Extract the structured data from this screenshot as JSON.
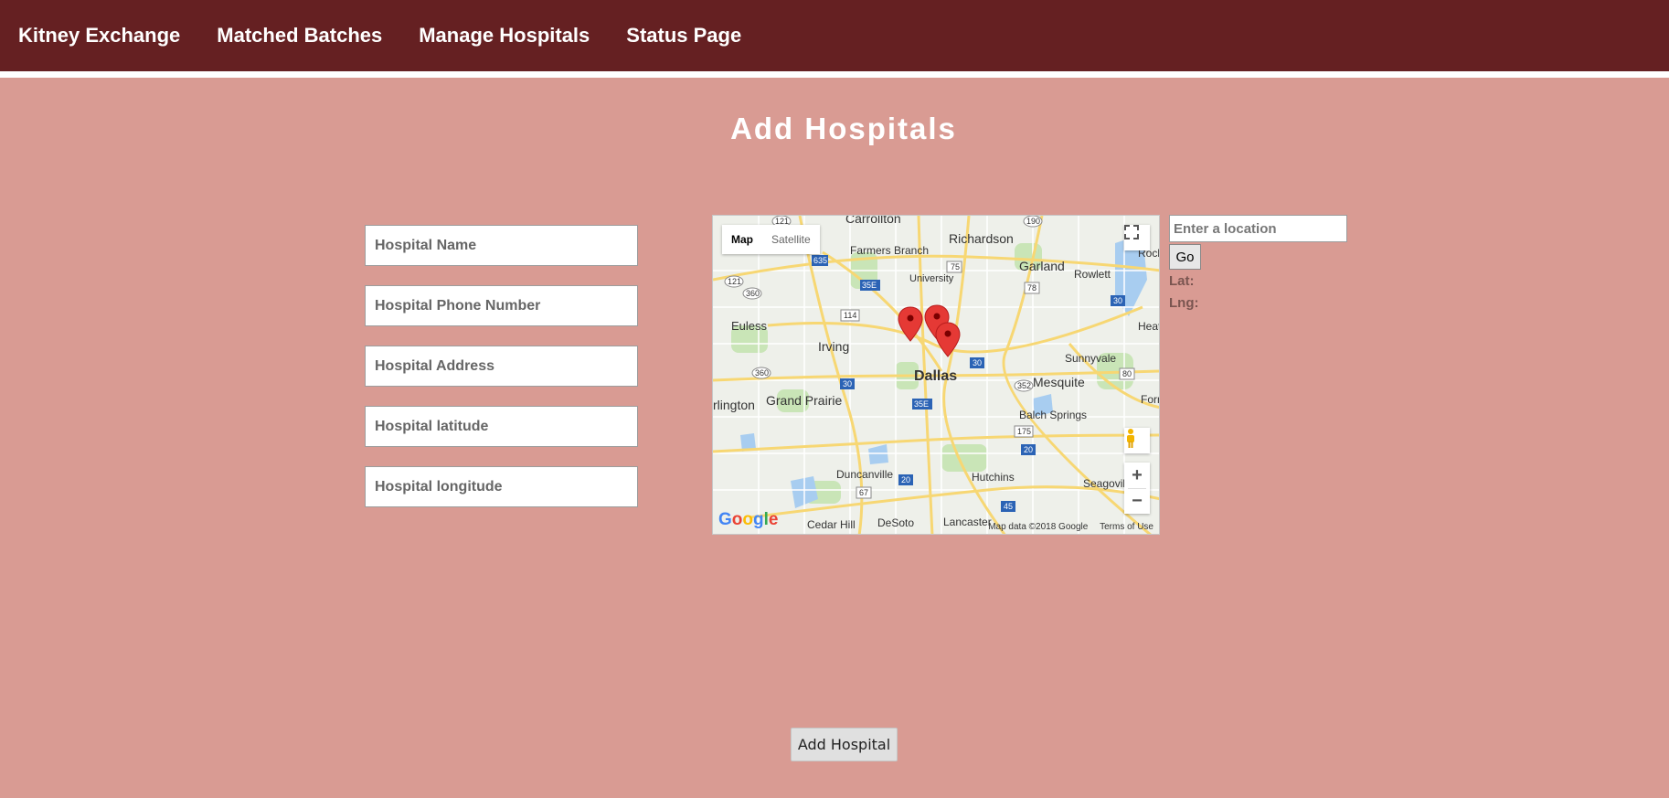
{
  "nav": {
    "items": [
      {
        "label": "Kitney Exchange"
      },
      {
        "label": "Matched Batches"
      },
      {
        "label": "Manage Hospitals"
      },
      {
        "label": "Status Page"
      }
    ]
  },
  "page": {
    "title": "Add Hospitals"
  },
  "form": {
    "name_placeholder": "Hospital Name",
    "phone_placeholder": "Hospital Phone Number",
    "address_placeholder": "Hospital Address",
    "latitude_placeholder": "Hospital latitude",
    "longitude_placeholder": "Hospital longitude",
    "submit_label": "Add Hospital"
  },
  "map": {
    "type_map_label": "Map",
    "type_satellite_label": "Satellite",
    "footer_data": "Map data ©2018 Google",
    "footer_terms": "Terms of Use",
    "google_label": "Google",
    "zoom_in": "+",
    "zoom_out": "−",
    "place_labels": [
      "Carrollton",
      "Richardson",
      "Garland",
      "Rowlett",
      "Rock",
      "Farmers Branch",
      "University",
      "Euless",
      "Irving",
      "Dallas",
      "Sunnyvale",
      "Heath",
      "Mesquite",
      "Grand Prairie",
      "rlington",
      "Balch Springs",
      "Duncanville",
      "Hutchins",
      "Seagovill",
      "Cedar Hill",
      "DeSoto",
      "Lancaster",
      "Forne"
    ],
    "road_labels": [
      "121",
      "190",
      "635",
      "75",
      "35E",
      "78",
      "121",
      "360",
      "114",
      "30",
      "360",
      "30",
      "352",
      "80",
      "35E",
      "175",
      "20",
      "20",
      "67",
      "45",
      "30"
    ]
  },
  "location_search": {
    "placeholder": "Enter a location",
    "go_label": "Go",
    "lat_label": "Lat:",
    "lng_label": "Lng:"
  },
  "colors": {
    "nav_bg": "#652022",
    "page_bg": "#d99b93",
    "marker": "#e53935"
  }
}
